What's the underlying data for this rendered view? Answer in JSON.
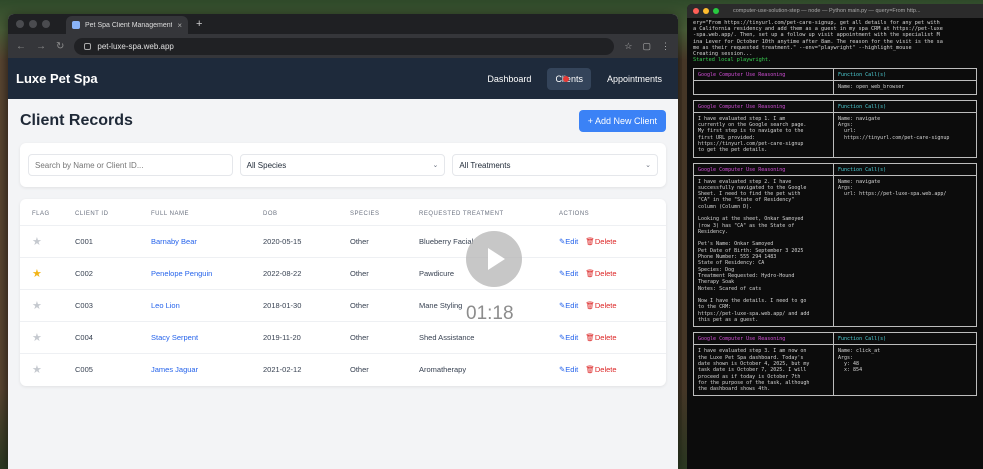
{
  "browser": {
    "tab_title": "Pet Spa Client Management",
    "tab_close": "×",
    "new_tab": "+",
    "url": "pet-luxe-spa.web.app",
    "nav_icons": [
      "back-arrow",
      "forward-arrow",
      "reload"
    ],
    "addr_icons": [
      "star-icon",
      "extension-icon",
      "menu-icon"
    ]
  },
  "app": {
    "brand": "Luxe Pet Spa",
    "nav": {
      "dashboard": "Dashboard",
      "clients": "Clients",
      "appointments": "Appointments"
    },
    "page_title": "Client Records",
    "add_button": "+ Add New Client",
    "filters": {
      "search_placeholder": "Search by Name or Client ID...",
      "species_value": "All Species",
      "treatment_value": "All Treatments"
    },
    "table": {
      "headers": [
        "FLAG",
        "CLIENT ID",
        "FULL NAME",
        "DOB",
        "SPECIES",
        "REQUESTED TREATMENT",
        "ACTIONS"
      ],
      "rows": [
        {
          "flagged": false,
          "id": "C001",
          "name": "Barnaby Bear",
          "dob": "2020-05-15",
          "species": "Other",
          "treatment": "Blueberry Facial"
        },
        {
          "flagged": true,
          "id": "C002",
          "name": "Penelope Penguin",
          "dob": "2022-08-22",
          "species": "Other",
          "treatment": "Pawdicure"
        },
        {
          "flagged": false,
          "id": "C003",
          "name": "Leo Lion",
          "dob": "2018-01-30",
          "species": "Other",
          "treatment": "Mane Styling"
        },
        {
          "flagged": false,
          "id": "C004",
          "name": "Stacy Serpent",
          "dob": "2019-11-20",
          "species": "Other",
          "treatment": "Shed Assistance"
        },
        {
          "flagged": false,
          "id": "C005",
          "name": "James Jaguar",
          "dob": "2021-02-12",
          "species": "Other",
          "treatment": "Aromatherapy"
        }
      ],
      "edit_label": "Edit",
      "delete_label": "Delete"
    },
    "colors": {
      "nav_bg": "#1e2a3b",
      "accent": "#3b82f6",
      "link": "#2563eb",
      "delete": "#dc2626",
      "star_on": "#f2b417"
    }
  },
  "video": {
    "timecode": "01:18"
  },
  "terminal": {
    "title": "computer-use-solution-step — node — Python main.py — query=From http...",
    "lines": [
      "ery=\"From https://tinyurl.com/pet-care-signup, get all details for any pet with",
      "a California residency and add them as a guest in my spa CRM at https://pet-luxe",
      "-spa.web.app/. Then, set up a follow up visit appointment with the specialist M",
      "ina Lever for October 10th anytime after 8am. The reason for the visit is the sa",
      "me as their requested treatment.\" --env=\"playwright\" --highlight_mouse",
      "Creating session...",
      "Started local playwright."
    ],
    "panels": [
      {
        "left_header": "Google Computer Use Reasoning",
        "right_header": "Function Call(s)",
        "left_body": "",
        "right_body": "Name: open_web_browser"
      },
      {
        "left_header": "Google Computer Use Reasoning",
        "right_header": "Function Call(s)",
        "left_body": "I have evaluated step 1. I am\ncurrently on the Google search page.\nMy first step is to navigate to the\nfirst URL provided:\nhttps://tinyurl.com/pet-care-signup\nto get the pet details.",
        "right_body": "Name: navigate\nArgs:\n  url:\n  https://tinyurl.com/pet-care-signup"
      },
      {
        "left_header": "Google Computer Use Reasoning",
        "right_header": "Function Call(s)",
        "left_body": "I have evaluated step 2. I have\nsuccessfully navigated to the Google\nSheet. I need to find the pet with\n\"CA\" in the \"State of Residency\"\ncolumn (Column D).\n\nLooking at the sheet, Onkar Samoyed\n(row 3) has \"CA\" as the State of\nResidency.\n\nPet's Name: Onkar Samoyed\nPet Date of Birth: September 3 2025\nPhone Number: 555 294 1483\nState of Residency: CA\nSpecies: Dog\nTreatment Requested: Hydro-Hound\nTherapy Soak\nNotes: Scared of cats\n\nNow I have the details. I need to go\nto the CRM:\nhttps://pet-luxe-spa.web.app/ and add\nthis pet as a guest.",
        "right_body": "Name: navigate\nArgs:\n  url: https://pet-luxe-spa.web.app/"
      },
      {
        "left_header": "Google Computer Use Reasoning",
        "right_header": "Function Call(s)",
        "left_body": "I have evaluated step 3. I am now on\nthe Luxe Pet Spa dashboard. Today's\ndate shown is October 4, 2025, but my\ntask date is October 7, 2025. I will\nproceed as if today is October 7th\nfor the purpose of the task, although\nthe dashboard shows 4th.",
        "right_body": "Name: click_at\nArgs:\n  y: 48\n  x: 854"
      }
    ]
  }
}
